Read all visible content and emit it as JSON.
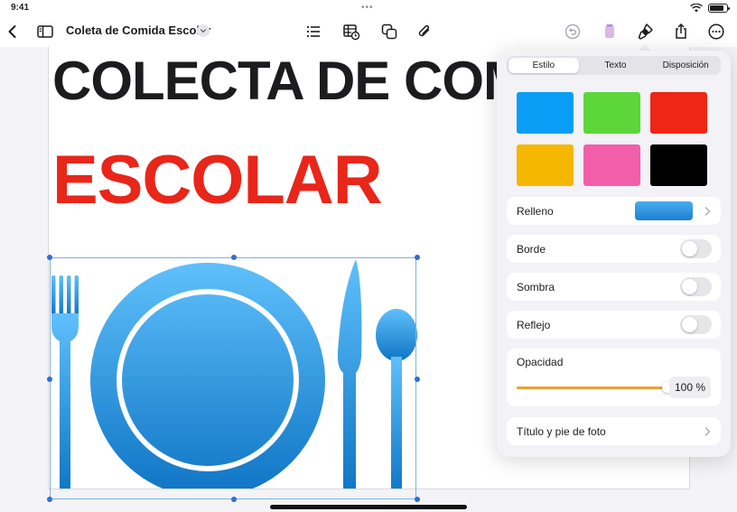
{
  "status": {
    "time": "9:41",
    "dots": "•••"
  },
  "toolbar": {
    "document_title": "Coleta de Comida Escolar",
    "icons": [
      "back-icon",
      "sidebar-icon",
      "chevron-down-icon",
      "list-icon",
      "table-clock-icon",
      "shapes-icon",
      "attachment-icon",
      "undo-icon",
      "trash-icon",
      "format-brush-icon",
      "share-icon",
      "more-icon"
    ]
  },
  "document": {
    "headline_line1": "COLECTA DE COMIDA",
    "headline_line2": "ESCOLAR"
  },
  "format_panel": {
    "tabs": [
      {
        "label": "Estilo",
        "active": true
      },
      {
        "label": "Texto",
        "active": false
      },
      {
        "label": "Disposición",
        "active": false
      }
    ],
    "swatches": [
      "#0a9df5",
      "#5cd639",
      "#ef2516",
      "#f6b700",
      "#f25eaa",
      "#000000"
    ],
    "rows": {
      "fill": {
        "label": "Relleno"
      },
      "border": {
        "label": "Borde",
        "on": false
      },
      "shadow": {
        "label": "Sombra",
        "on": false
      },
      "reflection": {
        "label": "Reflejo",
        "on": false
      }
    },
    "opacity": {
      "label": "Opacidad",
      "value_text": "100 %",
      "value": 100
    },
    "caption": {
      "label": "Título y pie de foto"
    }
  },
  "colors": {
    "accent": "#1d7fd0",
    "headline_red": "#e8261a",
    "slider": "#f0a030"
  }
}
